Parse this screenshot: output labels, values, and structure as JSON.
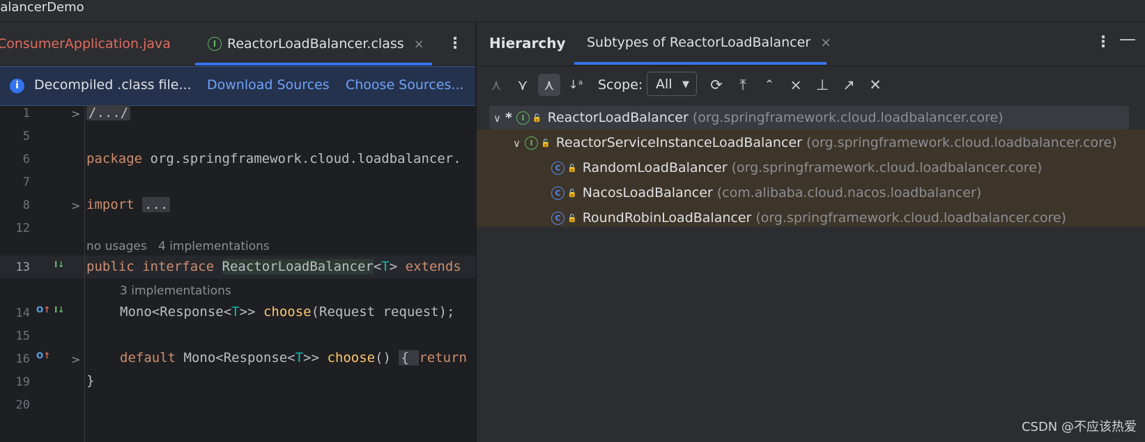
{
  "window": {
    "title": "BalancerDemo"
  },
  "editor": {
    "tabs": [
      {
        "label": "ConsumerApplication.java",
        "state": "error"
      },
      {
        "label": "ReactorLoadBalancer.class",
        "state": "active",
        "close": "×"
      }
    ],
    "more_icon": "⋮",
    "banner": {
      "text": "Decompiled .class file...",
      "links": [
        "Download Sources",
        "Choose Sources..."
      ]
    },
    "line_numbers": [
      "1",
      "5",
      "6",
      "7",
      "8",
      "12",
      "13",
      "14",
      "15",
      "16",
      "19",
      "20"
    ],
    "hints": {
      "usages": "no usages",
      "impl4": "4 implementations",
      "impl3": "3 implementations"
    },
    "code": {
      "l1": "/.../",
      "l6_kw": "package",
      "l6_rest": " org.springframework.cloud.loadbalancer.",
      "l8_kw": "import",
      "l8_fold": "...",
      "l13_kw1": "public",
      "l13_kw2": "interface",
      "l13_name": "ReactorLoadBalancer",
      "l13_lt": "<",
      "l13_t": "T",
      "l13_gt": "> ",
      "l13_ext": "extends",
      "l14_type": "Mono<Response<",
      "l14_t": "T",
      "l14_close": ">> ",
      "l14_m": "choose",
      "l14_args": "(Request request);",
      "l16_kw": "default",
      "l16_type": " Mono<Response<",
      "l16_t": "T",
      "l16_close": ">> ",
      "l16_m": "choose",
      "l16_paren": "() ",
      "l16_brace": "{ ",
      "l16_ret": "return",
      "l19": "}"
    }
  },
  "hierarchy": {
    "title": "Hierarchy",
    "tab_label": "Subtypes of ReactorLoadBalancer",
    "tab_close": "×",
    "more_icon": "⋮",
    "minimize_icon": "—",
    "scope_label": "Scope:",
    "scope_value": "All",
    "tree": [
      {
        "marker": "*",
        "name": "ReactorLoadBalancer",
        "pkg": "(org.springframework.cloud.loadbalancer.core)",
        "kind": "interface"
      },
      {
        "name": "ReactorServiceInstanceLoadBalancer",
        "pkg": "(org.springframework.cloud.loadbalancer.core)",
        "kind": "interface"
      },
      {
        "name": "RandomLoadBalancer",
        "pkg": "(org.springframework.cloud.loadbalancer.core)",
        "kind": "class"
      },
      {
        "name": "NacosLoadBalancer",
        "pkg": "(com.alibaba.cloud.nacos.loadbalancer)",
        "kind": "class"
      },
      {
        "name": "RoundRobinLoadBalancer",
        "pkg": "(org.springframework.cloud.loadbalancer.core)",
        "kind": "class"
      }
    ]
  },
  "watermark": "CSDN @不应该热爱",
  "colors": {
    "accent": "#3574f0",
    "keyword": "#cf8e6d",
    "method": "#ffc66d",
    "type_param": "#16baac",
    "tree_highlight": "#3d3529"
  }
}
